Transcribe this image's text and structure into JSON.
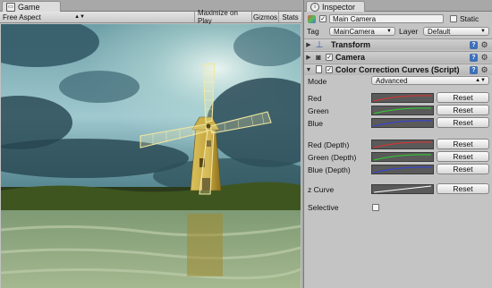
{
  "game": {
    "tab_label": "Game",
    "aspect": "Free Aspect",
    "maximize": "Maximize on Play",
    "gizmos": "Gizmos",
    "stats": "Stats"
  },
  "inspector": {
    "tab_label": "Inspector",
    "object_name": "Main Camera",
    "static_label": "Static",
    "tag_label": "Tag",
    "tag_value": "MainCamera",
    "layer_label": "Layer",
    "layer_value": "Default",
    "components": {
      "transform": "Transform",
      "camera": "Camera",
      "ccc": "Color Correction Curves (Script)"
    },
    "mode_label": "Mode",
    "mode_value": "Advanced",
    "curves": [
      {
        "label": "Red",
        "color": "#e03030"
      },
      {
        "label": "Green",
        "color": "#30d030"
      },
      {
        "label": "Blue",
        "color": "#3040e0"
      },
      {
        "label": "Red (Depth)",
        "color": "#e03030"
      },
      {
        "label": "Green (Depth)",
        "color": "#30d030"
      },
      {
        "label": "Blue (Depth)",
        "color": "#3040e0"
      },
      {
        "label": "z Curve",
        "color": "#ffffff"
      }
    ],
    "reset_label": "Reset",
    "selective_label": "Selective"
  }
}
